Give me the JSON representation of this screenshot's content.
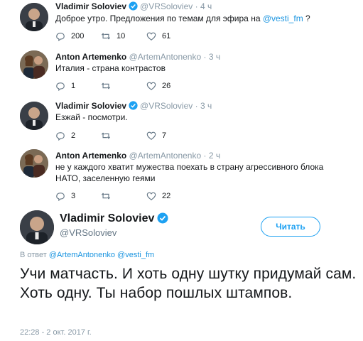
{
  "tweets": [
    {
      "name": "Vladimir Soloviev",
      "handle": "@VRSoloviev",
      "dot": "·",
      "time": "4 ч",
      "text_before": "Доброе утро. Предложения по темам для эфира на ",
      "mention": "@vesti_fm",
      "text_after": " ?",
      "replies": "200",
      "retweets": "10",
      "likes": "61",
      "verified": true
    },
    {
      "name": "Anton Artemenko",
      "handle": "@ArtemAntonenko",
      "dot": "·",
      "time": "3 ч",
      "text": "Италия - страна контрастов",
      "replies": "1",
      "retweets": "",
      "likes": "26",
      "verified": false
    },
    {
      "name": "Vladimir Soloviev",
      "handle": "@VRSoloviev",
      "dot": "·",
      "time": "3 ч",
      "text": "Езжай - посмотри.",
      "replies": "2",
      "retweets": "",
      "likes": "7",
      "verified": true
    },
    {
      "name": "Anton Artemenko",
      "handle": "@ArtemAntonenko",
      "dot": "·",
      "time": "2 ч",
      "text": "не у каждого хватит мужества поехать в страну агрессивного блока НАТО, заселенную геями",
      "replies": "3",
      "retweets": "",
      "likes": "22",
      "verified": false
    }
  ],
  "main_tweet": {
    "name": "Vladimir Soloviev",
    "handle": "@VRSoloviev",
    "follow_label": "Читать",
    "reply_prefix": "В ответ ",
    "reply_mention_1": "@ArtemAntonenko",
    "reply_mention_2": "@vesti_fm",
    "text": "Учи матчасть. И хоть одну шутку придумай сам. Хоть одну. Ты набор пошлых штампов.",
    "date": "22:28 - 2 окт. 2017 г."
  },
  "colors": {
    "accent": "#1da1f2",
    "mention": "#1b95e0",
    "muted": "#8899a6"
  },
  "icons": [
    "reply-icon",
    "retweet-icon",
    "like-icon",
    "verified-badge-icon"
  ]
}
